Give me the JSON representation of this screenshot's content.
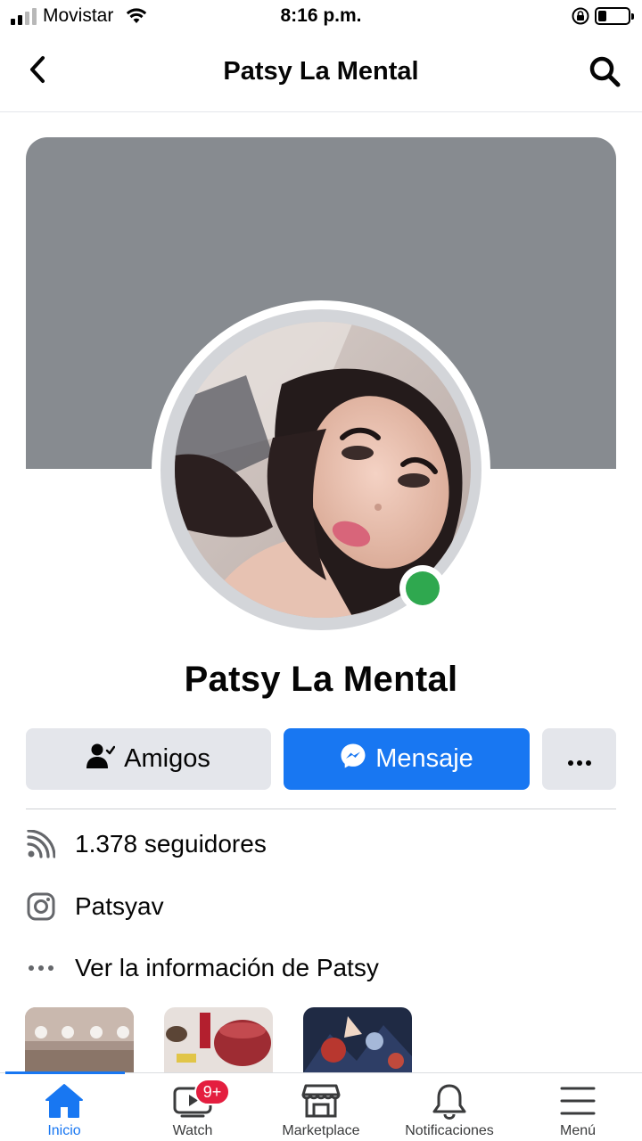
{
  "status_bar": {
    "carrier": "Movistar",
    "time": "8:16 p.m.",
    "signal_bars_active": 2,
    "signal_bars_total": 4,
    "battery_level": 0.25
  },
  "header": {
    "title": "Patsy La Mental",
    "back_icon": "chevron-left-icon",
    "search_icon": "search-icon"
  },
  "profile": {
    "name": "Patsy La Mental",
    "online": true,
    "cover_color": "#878b90",
    "online_color": "#2fa84f"
  },
  "actions": {
    "friends_label": "Amigos",
    "message_label": "Mensaje",
    "more_icon": "more-horizontal-icon"
  },
  "info": {
    "followers_text": "1.378 seguidores",
    "instagram_text": "Patsyav",
    "about_text": "Ver la información de Patsy"
  },
  "tabs": [
    {
      "label": "Inicio",
      "icon": "home-icon",
      "active": true
    },
    {
      "label": "Watch",
      "icon": "watch-icon",
      "badge": "9+"
    },
    {
      "label": "Marketplace",
      "icon": "store-icon"
    },
    {
      "label": "Notificaciones",
      "icon": "bell-icon"
    },
    {
      "label": "Menú",
      "icon": "menu-icon"
    }
  ],
  "colors": {
    "accent": "#1877f2",
    "badge": "#e41e3f",
    "button_gray": "#e4e6eb"
  }
}
